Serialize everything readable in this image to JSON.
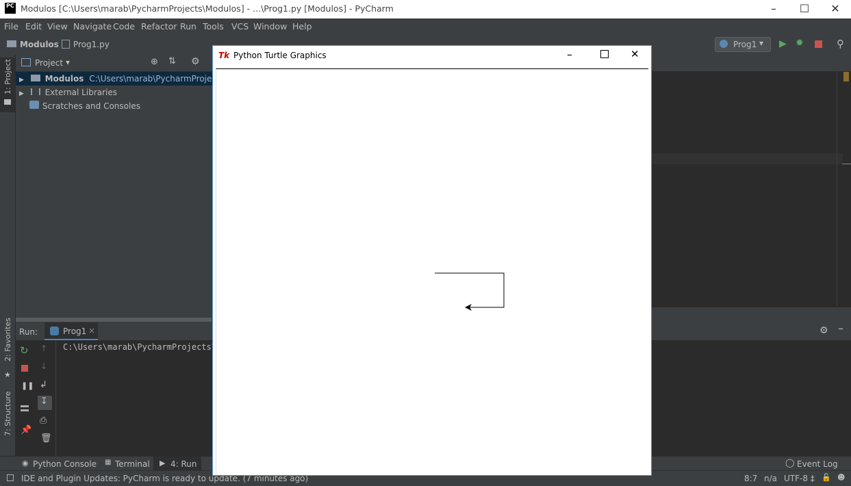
{
  "window": {
    "title": "Modulos [C:\\Users\\marab\\PycharmProjects\\Modulos] - ...\\Prog1.py [Modulos] - PyCharm",
    "logo": "PC"
  },
  "menu": [
    "File",
    "Edit",
    "View",
    "Navigate",
    "Code",
    "Refactor",
    "Run",
    "Tools",
    "VCS",
    "Window",
    "Help"
  ],
  "breadcrumb": {
    "project": "Modulos",
    "file": "Prog1.py"
  },
  "toolbar": {
    "run_config": "Prog1"
  },
  "sidebar_left": {
    "project_tab": "1: Project",
    "favorites_tab": "2: Favorites",
    "structure_tab": "7: Structure"
  },
  "project_panel": {
    "header": "Project",
    "items": [
      {
        "name": "Modulos",
        "path": "C:\\Users\\marab\\PycharmProjects\\Mo"
      },
      {
        "name": "External Libraries"
      },
      {
        "name": "Scratches and Consoles"
      }
    ]
  },
  "run_panel": {
    "label": "Run:",
    "tab": "Prog1",
    "output": "C:\\Users\\marab\\PycharmProjects\\"
  },
  "bottom_tabs": {
    "python_console": "Python Console",
    "terminal": "Terminal",
    "run": "4: Run",
    "event_log": "Event Log"
  },
  "status": {
    "message": "IDE and Plugin Updates: PyCharm is ready to update. (7 minutes ago)",
    "position": "8:7",
    "na": "n/a",
    "encoding": "UTF-8 ‡"
  },
  "turtle_window": {
    "title": "Python Turtle Graphics",
    "logo": "Tk"
  },
  "colors": {
    "accent": "#4a88c7",
    "background": "#3c3f41",
    "editor": "#2b2b2b",
    "run_green": "#4caf50",
    "stop_red": "#c75450"
  }
}
